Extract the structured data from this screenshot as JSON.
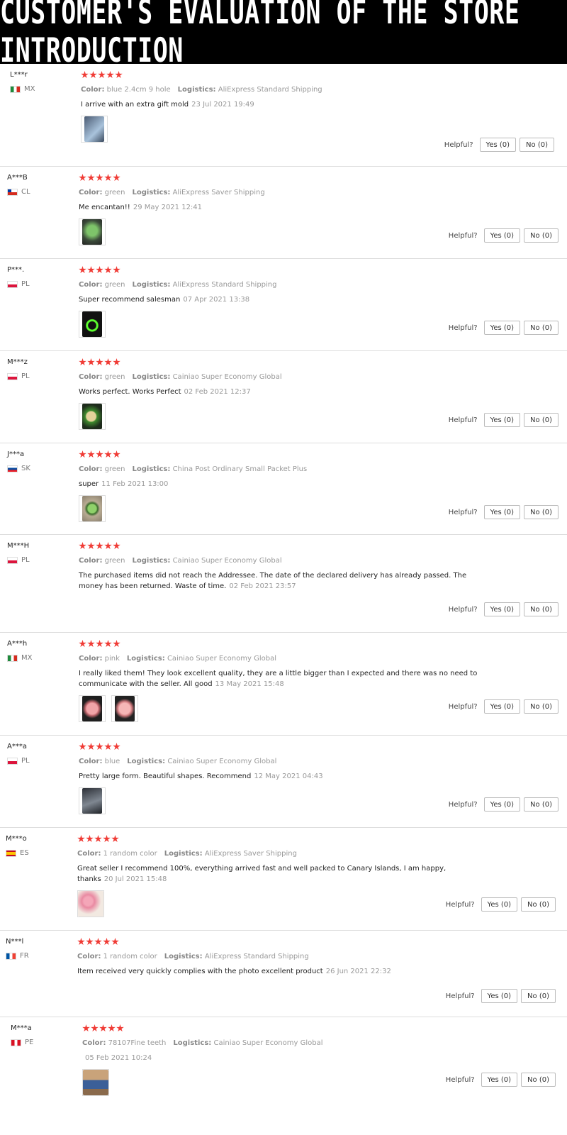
{
  "banner": {
    "title": "CUSTOMER'S EVALUATION OF THE STORE INTRODUCTION"
  },
  "labels": {
    "color": "Color:",
    "logistics": "Logistics:",
    "helpful": "Helpful?",
    "yes": "Yes (0)",
    "no": "No (0)"
  },
  "rating": {
    "stars": 5,
    "color": "#f03b35"
  },
  "reviews": [
    {
      "user": "L***r",
      "country": "MX",
      "color": "blue 2.4cm 9 hole",
      "logistics": "AliExpress Standard Shipping",
      "text": "I arrive with an extra gift mold",
      "date": "23 Jul 2021 19:49",
      "photos": 1
    },
    {
      "user": "A***B",
      "country": "CL",
      "color": "green",
      "logistics": "AliExpress Saver Shipping",
      "text": "Me encantan!!",
      "date": "29 May 2021 12:41",
      "photos": 1
    },
    {
      "user": "P***.",
      "country": "PL",
      "color": "green",
      "logistics": "AliExpress Standard Shipping",
      "text": "Super recommend salesman",
      "date": "07 Apr 2021 13:38",
      "photos": 1
    },
    {
      "user": "M***z",
      "country": "PL",
      "color": "green",
      "logistics": "Cainiao Super Economy Global",
      "text": "Works perfect. Works Perfect",
      "date": "02 Feb 2021 12:37",
      "photos": 1
    },
    {
      "user": "J***a",
      "country": "SK",
      "color": "green",
      "logistics": "China Post Ordinary Small Packet Plus",
      "text": "super",
      "date": "11 Feb 2021 13:00",
      "photos": 1
    },
    {
      "user": "M***H",
      "country": "PL",
      "color": "green",
      "logistics": "Cainiao Super Economy Global",
      "text": "The purchased items did not reach the Addressee. The date of the declared delivery has already passed. The money has been returned. Waste of time.",
      "date": "02 Feb 2021 23:57",
      "photos": 0
    },
    {
      "user": "A***h",
      "country": "MX",
      "color": "pink",
      "logistics": "Cainiao Super Economy Global",
      "text": "I really liked them! They look excellent quality, they are a little bigger than I expected and there was no need to communicate with the seller. All good",
      "date": "13 May 2021 15:48",
      "photos": 2
    },
    {
      "user": "A***a",
      "country": "PL",
      "color": "blue",
      "logistics": "Cainiao Super Economy Global",
      "text": "Pretty large form. Beautiful shapes. Recommend",
      "date": "12 May 2021 04:43",
      "photos": 1
    },
    {
      "user": "M***o",
      "country": "ES",
      "color": "1 random color",
      "logistics": "AliExpress Saver Shipping",
      "text": "Great seller I recommend 100%, everything arrived fast and well packed to Canary Islands, I am happy, thanks",
      "date": "20 Jul 2021 15:48",
      "photos": 1
    },
    {
      "user": "N***l",
      "country": "FR",
      "color": "1 random color",
      "logistics": "AliExpress Standard Shipping",
      "text": "Item received very quickly complies with the photo excellent product",
      "date": "26 Jun 2021 22:32",
      "photos": 0
    },
    {
      "user": "M***a",
      "country": "PE",
      "color": "78107Fine teeth",
      "logistics": "Cainiao Super Economy Global",
      "text": "",
      "date": "05 Feb 2021 10:24",
      "photos": 1
    }
  ]
}
